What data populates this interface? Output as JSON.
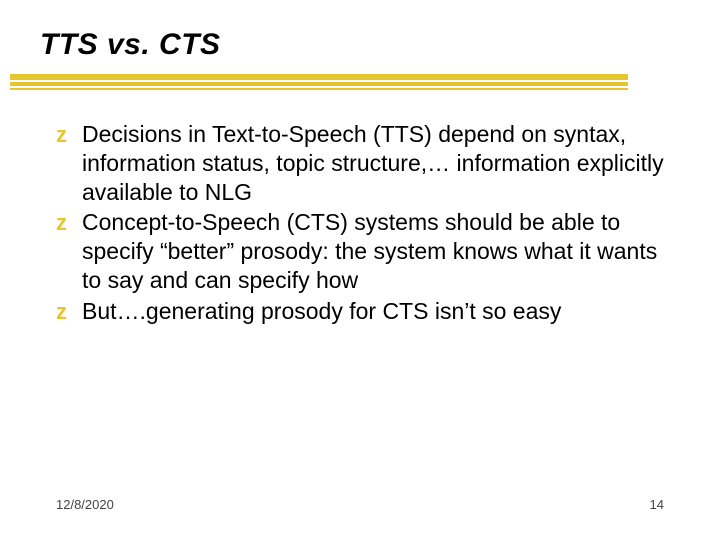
{
  "slide": {
    "title": "TTS vs. CTS",
    "bullets": [
      "Decisions in Text-to-Speech (TTS) depend on syntax, information status, topic structure,… information explicitly available to NLG",
      "Concept-to-Speech (CTS) systems should be able to specify “better” prosody: the system knows what it wants to say and can specify how",
      "But….generating prosody for CTS isn’t so easy"
    ],
    "bullet_glyph": "z",
    "footer": {
      "date": "12/8/2020",
      "page": "14"
    }
  },
  "colors": {
    "accent": "#e6c52f"
  }
}
